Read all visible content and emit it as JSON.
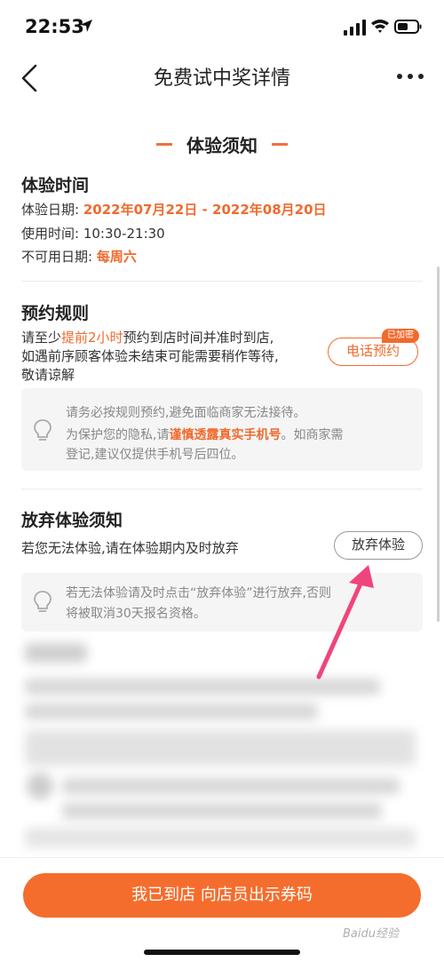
{
  "status_bar": {
    "time": "22:53"
  },
  "nav": {
    "title": "免费试中奖详情"
  },
  "section": {
    "title": "体验须知"
  },
  "experience_time": {
    "title": "体验时间",
    "date_label": "体验日期:",
    "date_value": "2022年07月22日 - 2022年08月20日",
    "use_time_label": "使用时间:",
    "use_time_value": "10:30-21:30",
    "unavailable_label": "不可用日期:",
    "unavailable_value": "每周六"
  },
  "booking_rules": {
    "title": "预约规则",
    "line1_pre": "请至少",
    "line1_highlight": "提前2小时",
    "line1_post": "预约到店时间并准时到店,",
    "line2": "如遇前序顾客体验未结束可能需要稍作等待,",
    "line3": "敬请谅解",
    "call_button": "电话预约",
    "encrypted_badge": "已加密",
    "tip_line1": "请务必按规则预约,避免面临商家无法接待。",
    "tip_line2_pre": "为保护您的隐私,请",
    "tip_line2_highlight": "谨慎透露真实手机号",
    "tip_line2_post": "。如商家需",
    "tip_line3": "登记,建议仅提供手机号后四位。"
  },
  "give_up": {
    "title": "放弃体验须知",
    "desc": "若您无法体验,请在体验期内及时放弃",
    "button": "放弃体验",
    "tip_line1": "若无法体验请及时点击“放弃体验”进行放弃,否则",
    "tip_line2": "将被取消30天报名资格。"
  },
  "bottom": {
    "primary_button": "我已到店 向店员出示券码"
  },
  "watermark": "Baidu经验",
  "colors": {
    "accent": "#f06a2d",
    "button": "#f56d2d",
    "arrow": "#f0457a"
  },
  "icons": [
    "location-arrow-icon",
    "signal-icon",
    "wifi-icon",
    "battery-icon",
    "back-icon",
    "more-icon",
    "lightbulb-icon"
  ]
}
